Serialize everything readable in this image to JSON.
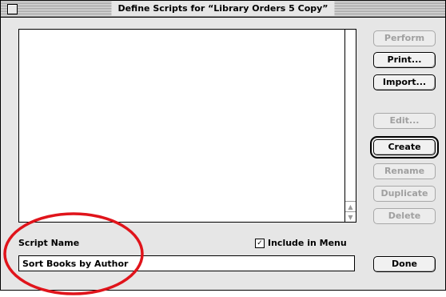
{
  "window": {
    "title": "Define Scripts for “Library Orders 5 Copy”"
  },
  "script_list": {
    "items": []
  },
  "buttons": {
    "perform": "Perform",
    "print": "Print...",
    "import": "Import...",
    "edit": "Edit...",
    "create": "Create",
    "rename": "Rename",
    "duplicate": "Duplicate",
    "delete": "Delete",
    "done": "Done"
  },
  "script_name": {
    "label": "Script Name",
    "value": "Sort Books by Author"
  },
  "include_in_menu": {
    "label": "Include in Menu",
    "checked": true
  },
  "colors": {
    "annotation": "#e0141b"
  },
  "icons": {
    "scroll_up": "scroll-up-arrow-icon",
    "scroll_down": "scroll-down-arrow-icon",
    "checkmark": "checkmark-icon"
  }
}
